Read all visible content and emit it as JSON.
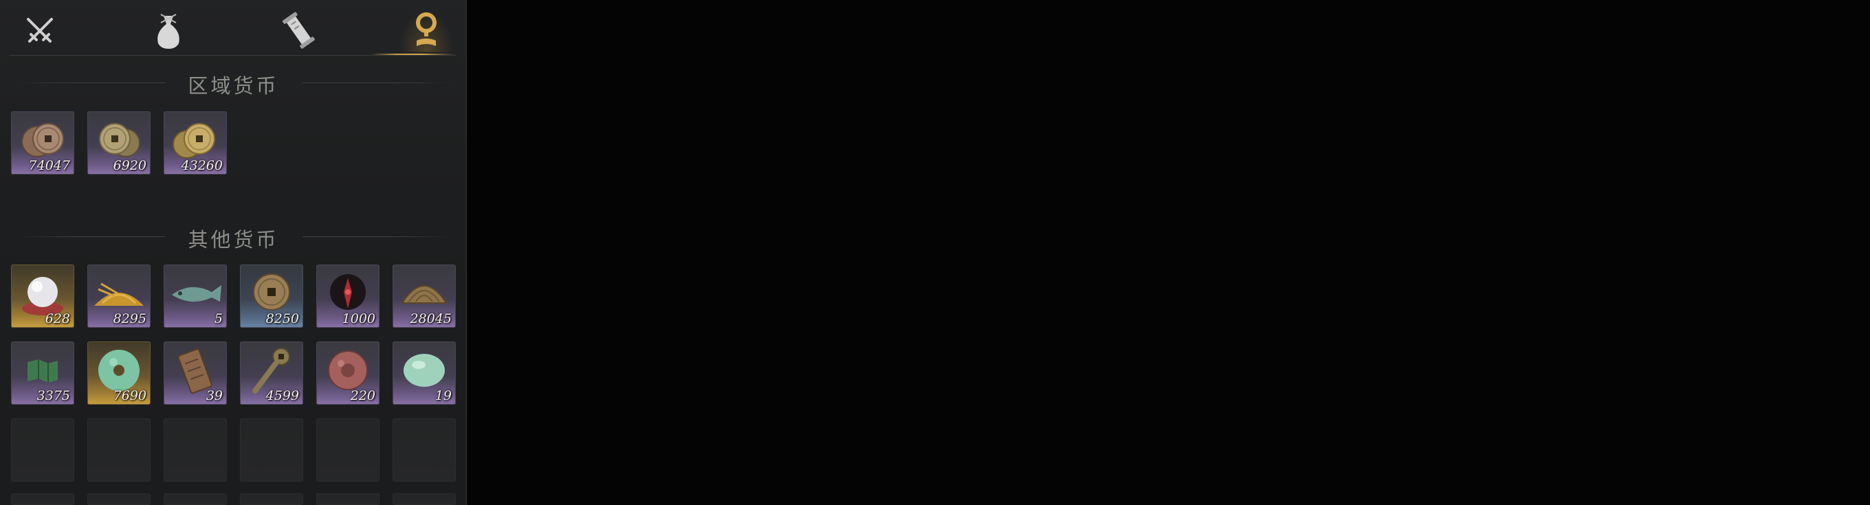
{
  "tabs": [
    {
      "icon": "crossed-swords-icon",
      "active": false
    },
    {
      "icon": "pouch-icon",
      "active": false
    },
    {
      "icon": "scroll-icon",
      "active": false
    },
    {
      "icon": "currency-icon",
      "active": true
    }
  ],
  "colors": {
    "accent": "#c89a45",
    "rarity_purple": "#8a72a8",
    "rarity_gold": "#c9a040",
    "rarity_blue": "#6a84a6"
  },
  "regional": {
    "title": "区域货币",
    "items": [
      {
        "icon": "copper-coins-icon",
        "count": "74047",
        "rarity": "purple"
      },
      {
        "icon": "bronze-coins-icon",
        "count": "6920",
        "rarity": "purple"
      },
      {
        "icon": "gold-coins-icon",
        "count": "43260",
        "rarity": "purple"
      }
    ]
  },
  "other": {
    "title": "其他货币",
    "items": [
      {
        "icon": "pearl-icon",
        "count": "628",
        "rarity": "gold"
      },
      {
        "icon": "grain-pile-icon",
        "count": "8295",
        "rarity": "purple"
      },
      {
        "icon": "jade-fish-icon",
        "count": "5",
        "rarity": "purple"
      },
      {
        "icon": "ancient-coin-icon",
        "count": "8250",
        "rarity": "blue"
      },
      {
        "icon": "red-sigil-icon",
        "count": "1000",
        "rarity": "purple"
      },
      {
        "icon": "shell-coin-icon",
        "count": "28045",
        "rarity": "purple"
      },
      {
        "icon": "jade-map-icon",
        "count": "3375",
        "rarity": "purple"
      },
      {
        "icon": "jade-bi-disc-icon",
        "count": "7690",
        "rarity": "gold"
      },
      {
        "icon": "bronze-token-icon",
        "count": "39",
        "rarity": "purple"
      },
      {
        "icon": "key-coin-icon",
        "count": "4599",
        "rarity": "purple"
      },
      {
        "icon": "red-stone-coin-icon",
        "count": "220",
        "rarity": "purple"
      },
      {
        "icon": "jade-stone-icon",
        "count": "19",
        "rarity": "purple"
      }
    ]
  }
}
